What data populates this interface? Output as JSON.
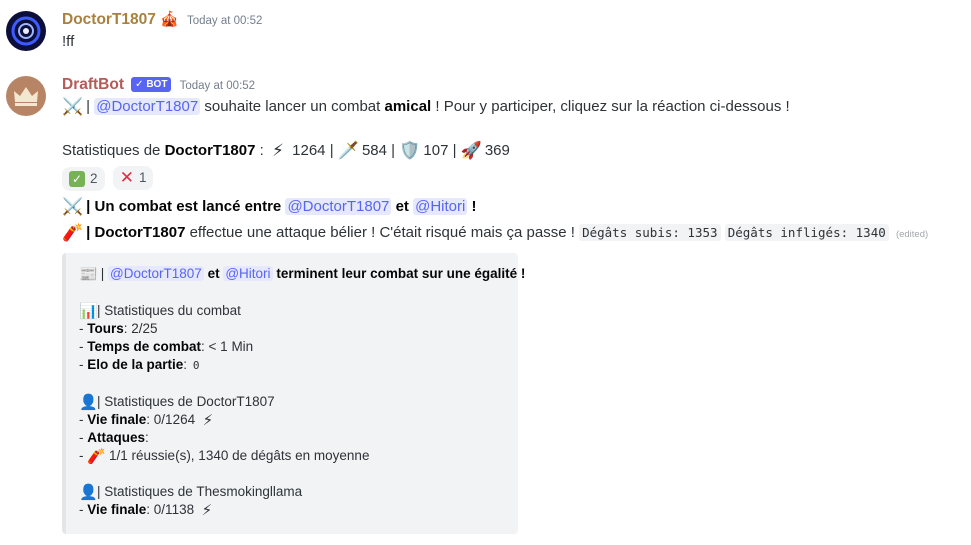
{
  "colors": {
    "doctor_name": "#a8813f",
    "bot_name": "#b65a57",
    "mention": "#5865f2"
  },
  "msg1": {
    "username": "DoctorT1807",
    "badge_icon": "emoji-badge-icon",
    "timestamp": "Today at 00:52",
    "text": "!ff"
  },
  "msg2": {
    "username": "DraftBot",
    "bot_tag": "✓ BOT",
    "timestamp": "Today at 00:52",
    "line1": {
      "emoji": "⚔️",
      "sep": "|",
      "mention": "@DoctorT1807",
      "pre": "souhaite lancer un combat",
      "bold": "amical",
      "post": "! Pour y participer, cliquez sur la réaction ci-dessous !"
    },
    "stats": {
      "label": "Statistiques de",
      "name": "DoctorT1807",
      "colon": ":",
      "vals": [
        "1264",
        "584",
        "107",
        "369"
      ],
      "seps": "|"
    },
    "reactions": [
      {
        "icon": "check-mark-icon",
        "count": "2"
      },
      {
        "icon": "cross-mark-icon",
        "count": "1"
      }
    ]
  },
  "combat_line": {
    "sep": "|",
    "bold_pre": "Un combat est lancé entre",
    "mention1": "@DoctorT1807",
    "and": "et",
    "mention2": "@Hitori",
    "excl": "!"
  },
  "attack_line": {
    "sep": "|",
    "name": "DoctorT1807",
    "text": "effectue une attaque bélier ! C'était risqué mais ça passe !",
    "code1": "Dégâts subis: 1353",
    "code2": "Dégâts infligés: 1340",
    "edited": "(edited)"
  },
  "embed": {
    "title": {
      "sep": "|",
      "mention1": "@DoctorT1807",
      "and": "et",
      "mention2": "@Hitori",
      "rest": "terminent leur combat sur une égalité !"
    },
    "combat_header": "| Statistiques du combat",
    "tours": {
      "label": "Tours",
      "value": ": 2/25"
    },
    "temps": {
      "label": "Temps de combat",
      "value": ": < 1 Min"
    },
    "elo": {
      "label": "Elo de la partie",
      "colon": ":",
      "code": "0"
    },
    "p1_header": "| Statistiques de DoctorT1807",
    "p1_vie": {
      "label": "Vie finale",
      "value": ": 0/1264"
    },
    "p1_attacks": {
      "label": "Attaques",
      "colon": ":"
    },
    "p1_attack_item": "1/1 réussie(s), 1340 de dégâts en moyenne",
    "p2_header": "| Statistiques de Thesmokingllama",
    "p2_vie": {
      "label": "Vie finale",
      "value": ": 0/1138"
    },
    "dash": "-"
  }
}
